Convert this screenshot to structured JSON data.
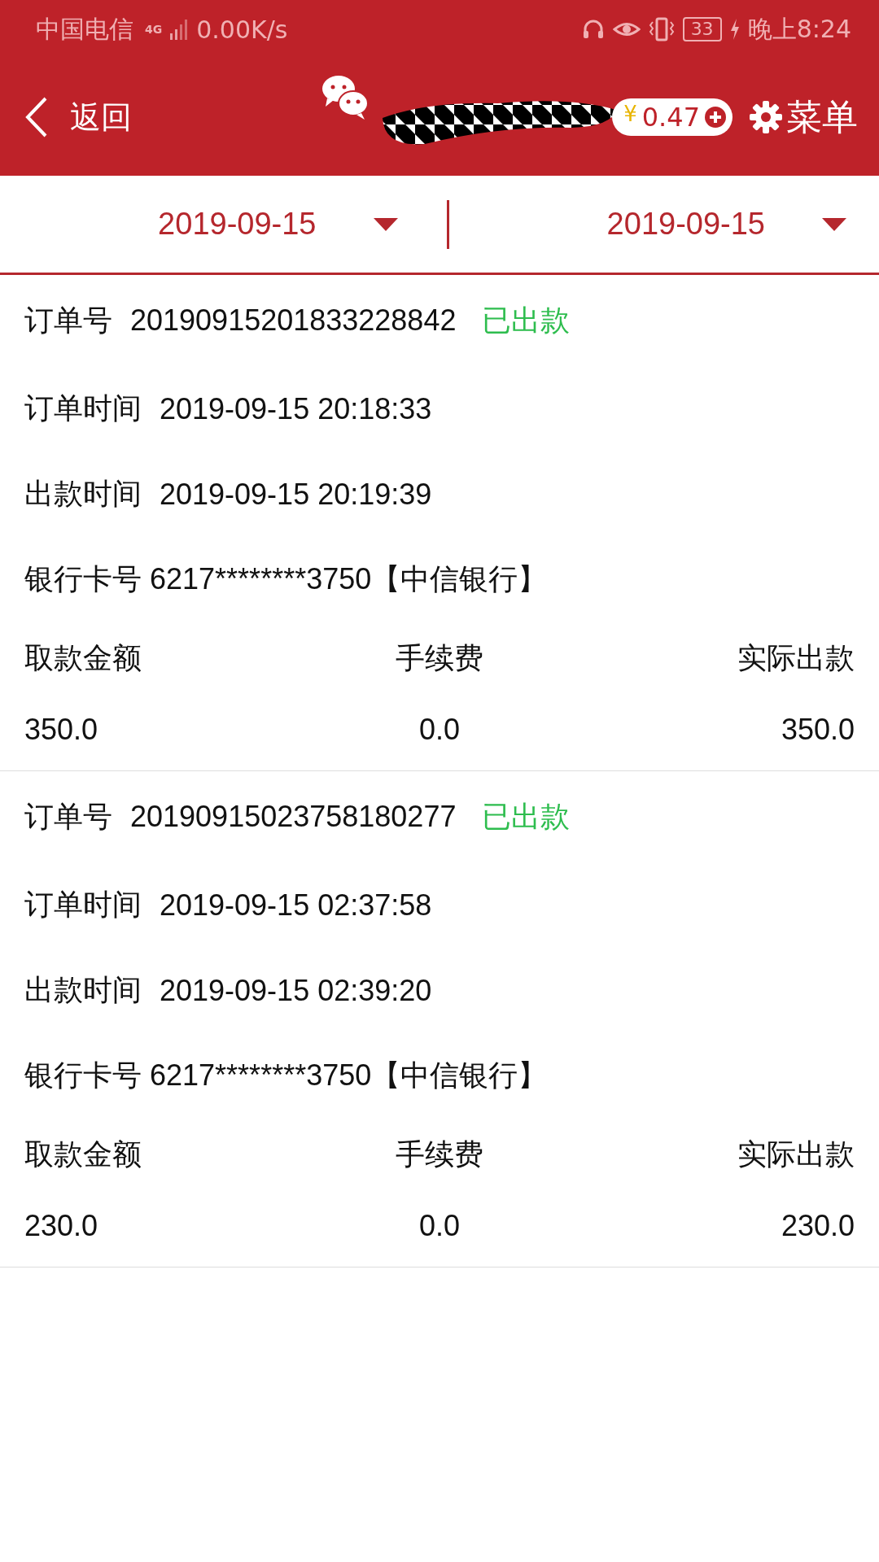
{
  "status_bar": {
    "carrier": "中国电信",
    "network": "4G",
    "speed": "0.00K/s",
    "battery": "33",
    "time": "晚上8:24"
  },
  "header": {
    "back": "返回",
    "balance_currency": "¥",
    "balance": "0.47",
    "menu": "菜单"
  },
  "date_filter": {
    "start": "2019-09-15",
    "end": "2019-09-15"
  },
  "orders": [
    {
      "order_label": "订单号",
      "order_no": "20190915201833228842",
      "status": {
        "text": "已出款",
        "color": "#2ebd4e"
      },
      "order_time_label": "订单时间",
      "order_time": "2019-09-15 20:18:33",
      "payout_time_label": "出款时间",
      "payout_time": "2019-09-15 20:19:39",
      "card": "银行卡号 6217********3750【中信银行】",
      "columns": [
        "取款金额",
        "手续费",
        "实际出款"
      ],
      "values": [
        "350.0",
        "0.0",
        "350.0"
      ]
    },
    {
      "order_label": "订单号",
      "order_no": "20190915023758180277",
      "status": {
        "text": "已出款",
        "color": "#2ebd4e"
      },
      "order_time_label": "订单时间",
      "order_time": "2019-09-15 02:37:58",
      "payout_time_label": "出款时间",
      "payout_time": "2019-09-15 02:39:20",
      "card": "银行卡号 6217********3750【中信银行】",
      "columns": [
        "取款金额",
        "手续费",
        "实际出款"
      ],
      "values": [
        "230.0",
        "0.0",
        "230.0"
      ]
    }
  ]
}
